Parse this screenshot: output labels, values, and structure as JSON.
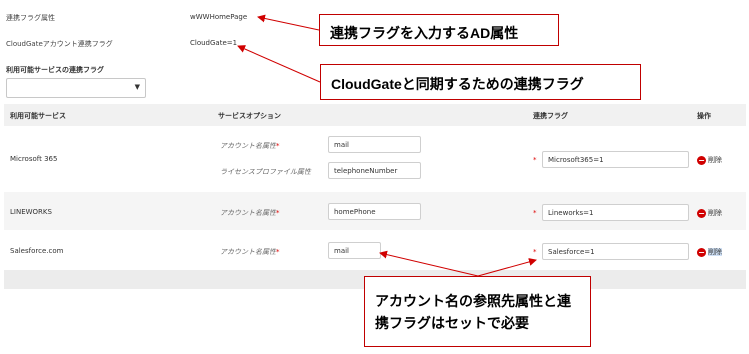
{
  "form": {
    "attr_label": "連携フラグ属性",
    "attr_value": "wWWHomePage",
    "flag_label": "CloudGateアカウント連携フラグ",
    "flag_value": "CloudGate=1",
    "services_label": "利用可能サービスの連携フラグ",
    "services_select_value": ""
  },
  "table": {
    "headers": [
      "利用可能サービス",
      "サービスオプション",
      "連携フラグ",
      "操作"
    ],
    "rows": [
      {
        "service": "Microsoft 365",
        "options": [
          {
            "label": "アカウント名属性",
            "required": "*",
            "value": "mail"
          },
          {
            "label": "ライセンスプロファイル属性",
            "required": "",
            "value": "telephoneNumber"
          }
        ],
        "flag": "Microsoft365=1",
        "action": "削除"
      },
      {
        "service": "LINEWORKS",
        "options": [
          {
            "label": "アカウント名属性",
            "required": "*",
            "value": "homePhone"
          }
        ],
        "flag": "Lineworks=1",
        "action": "削除"
      },
      {
        "service": "Salesforce.com",
        "options": [
          {
            "label": "アカウント名属性",
            "required": "*",
            "value": "mail"
          }
        ],
        "flag": "Salesforce=1",
        "action": "削除"
      }
    ]
  },
  "callouts": {
    "c1": "連携フラグを入力するAD属性",
    "c2": "CloudGateと同期するための連携フラグ",
    "c3_line1": "アカウント名の参照先属性と連",
    "c3_line2": "携フラグはセットで必要"
  },
  "colors": {
    "accent": "#d00000",
    "callout_border": "#c00000"
  },
  "icons": {
    "delete": "minus-circle-icon",
    "select": "chevron-down-icon"
  }
}
